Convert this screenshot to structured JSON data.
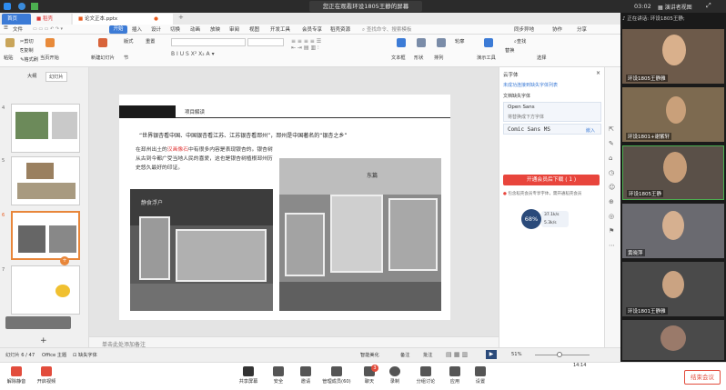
{
  "meeting": {
    "share_notice": "您正在观看环设1805王静的屏幕",
    "time": "03:02",
    "view_label": "演讲者视图",
    "speaking": "正在讲话: 环设1805王静;"
  },
  "wps": {
    "tabs": [
      {
        "label": "首页"
      },
      {
        "label": "稻壳"
      },
      {
        "label": "论文正本.pptx"
      }
    ],
    "ribbon_tabs": [
      "文件",
      "开始",
      "插入",
      "设计",
      "切换",
      "动画",
      "放映",
      "审阅",
      "视图",
      "开发工具",
      "会员专享",
      "稻壳资源"
    ],
    "search_placeholder": "查找命令、搜索模板",
    "top_right": [
      "同步异地",
      "协作",
      "分享"
    ],
    "ribbon": {
      "paste": "粘贴",
      "cut": "剪切",
      "copy": "复制",
      "format": "格式刷",
      "from_current": "当页开始",
      "new_slide": "新建幻灯片",
      "layout": "版式",
      "section": "节",
      "reset": "重置",
      "textbox": "文本框",
      "shape": "形状",
      "arrange": "排列",
      "outline": "轮廓",
      "presentation_tool": "演示工具",
      "replace": "替换",
      "select": "选择",
      "find": "查找",
      "font_placeholder": "默认字体"
    },
    "panel_tabs": [
      "大纲",
      "幻灯片"
    ],
    "slide_numbers": [
      "4",
      "5",
      "6",
      "7"
    ],
    "slide": {
      "header": "项目解读",
      "quote": "“世界银杏看中国、中国银杏看江苏、江苏银杏看邳州”，邳州是中国著名的“银杏之乡”",
      "body_1": "在邳州出土的",
      "body_highlight": "汉画像石",
      "body_2": "中有很多内容是表现银杏的。银杏树从古到今都广受当地人民的喜爱，这也是银杏树植根邳州历史悠久最好的印证。",
      "image_caption_left": "静食浮户",
      "image_caption_right": "东篇"
    },
    "notes": "单击此处添加备注",
    "status": {
      "slide_count": "幻灯片 6 / 47",
      "theme": "Office 主题",
      "font_missing": "缺失字体",
      "smart": "智能美化",
      "notes_btn": "备注",
      "review": "批注",
      "zoom": "51%"
    }
  },
  "right_panel": {
    "title": "云字体",
    "link": "未成功连接到缺失字体列表",
    "section": "文档缺失字体",
    "fonts": [
      {
        "name": "Open Sans",
        "desc": "将替换成下方字体"
      },
      {
        "name": "Comic Sans MS",
        "action": "嵌入"
      }
    ],
    "button": "开通会员后下载 ( 1 )",
    "warning": "包含稻壳会员专享字体，需开通稻壳会员",
    "perf_value": "68%",
    "perf_up": "37.1k/s",
    "perf_down": "5.3k/s"
  },
  "participants": [
    {
      "name": "环设1805王静雅"
    },
    {
      "name": "环设1801+谢紫轩"
    },
    {
      "name": "环设1805王静"
    },
    {
      "name": "黄晓萍"
    },
    {
      "name": "环设1801王静雅"
    },
    {
      "name": ""
    }
  ],
  "meeting_bar": {
    "left": [
      "解除静音",
      "开启视频"
    ],
    "center": [
      {
        "label": "共享屏幕"
      },
      {
        "label": "安全"
      },
      {
        "label": "邀请"
      },
      {
        "label": "管理成员(60)"
      },
      {
        "label": "聊天",
        "badge": "3"
      },
      {
        "label": "录制"
      },
      {
        "label": "分组讨论"
      },
      {
        "label": "应用"
      },
      {
        "label": "设置"
      }
    ],
    "end": "结束会议",
    "clock": "14:14"
  },
  "colors": {
    "accent": "#3c7bd6",
    "download": "#e8453c",
    "end": "#e24c3c",
    "highlight": "#e23b3b"
  }
}
